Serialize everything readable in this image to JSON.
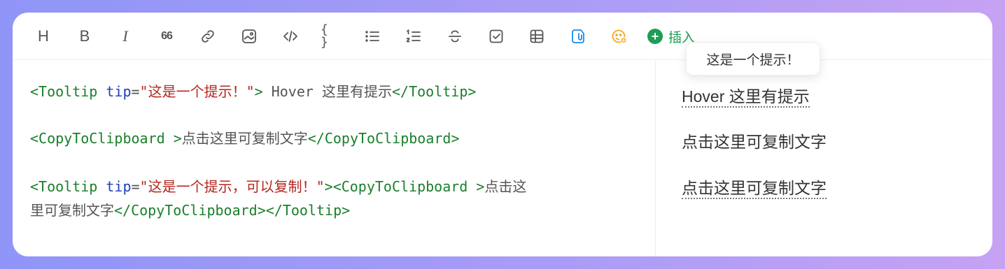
{
  "toolbar": {
    "heading_label": "H",
    "bold_label": "B",
    "italic_label": "I",
    "quote_label": "66",
    "code_block_label": "{ }",
    "insert_label": "插入",
    "insert_plus": "+"
  },
  "editor": {
    "line1": {
      "tag_open": "<Tooltip ",
      "attr": "tip",
      "eq": "=",
      "str": "\"这是一个提示！\"",
      "tag_close": ">",
      "text": " Hover 这里有提示",
      "tag_end": "</Tooltip>"
    },
    "line2": {
      "tag_open": "<CopyToClipboard >",
      "text": "点击这里可复制文字",
      "tag_end": "</CopyToClipboard>"
    },
    "line3": {
      "tag_open": "<Tooltip ",
      "attr": "tip",
      "eq": "=",
      "str": "\"这是一个提示，可以复制！\"",
      "tag_close": ">",
      "tag_open2": "<CopyToClipboard >",
      "text": "点击这"
    },
    "line4": {
      "text": "里可复制文字",
      "tag_end": "</CopyToClipboard></Tooltip>"
    }
  },
  "preview": {
    "tooltip_text": "这是一个提示！",
    "item1": "Hover 这里有提示",
    "item2": "点击这里可复制文字",
    "item3": "点击这里可复制文字"
  },
  "colors": {
    "tag": "#1a7f2a",
    "attr": "#1f3fb8",
    "string": "#b3261e",
    "insert": "#1f9d55",
    "clipboard_icon": "#1e88e5",
    "emoji_icon": "#f5a623"
  }
}
